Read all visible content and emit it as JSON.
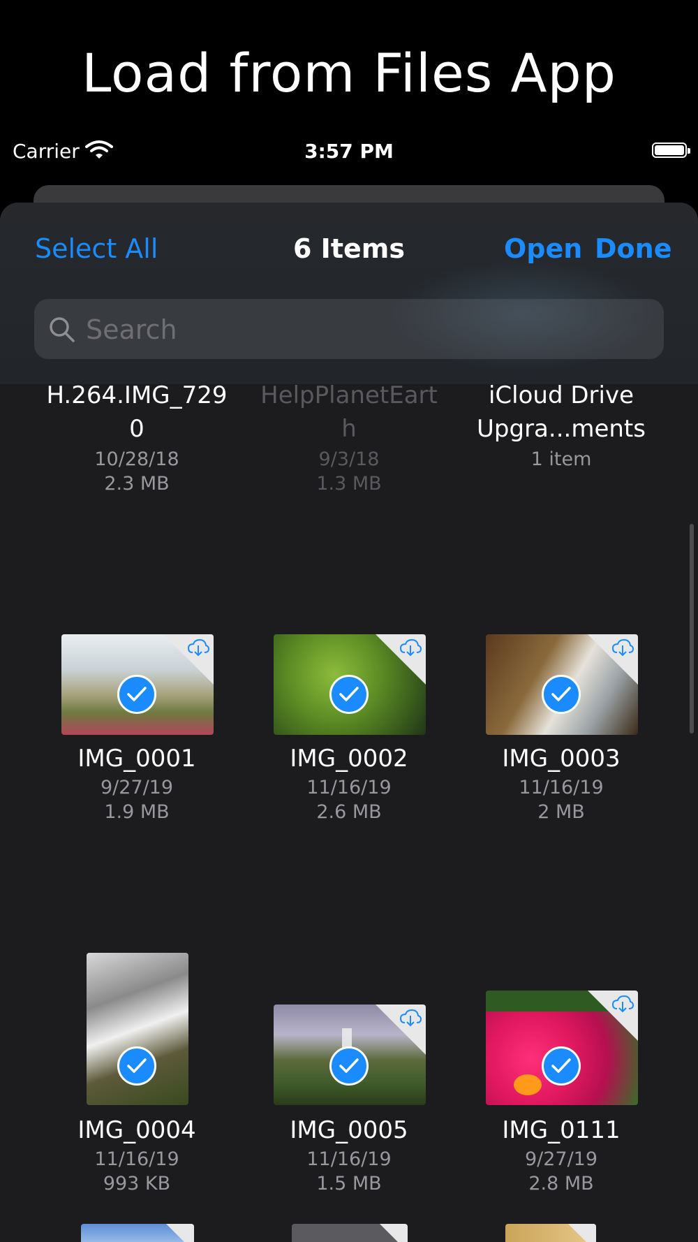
{
  "headline": "Load from Files App",
  "status_bar": {
    "carrier": "Carrier",
    "time": "3:57 PM"
  },
  "nav": {
    "left": "Select All",
    "title": "6 Items",
    "open": "Open",
    "done": "Done"
  },
  "search": {
    "placeholder": "Search"
  },
  "top_row": [
    {
      "name": "H.264.IMG_729\n0",
      "date": "10/28/18",
      "size": "2.3 MB"
    },
    {
      "name": "HelpPlanetEart\nh",
      "date": "9/3/18",
      "size": "1.3 MB"
    },
    {
      "name": "iCloud Drive\nUpgra...ments",
      "date": "1 item",
      "size": ""
    }
  ],
  "files": [
    {
      "name": "IMG_0001",
      "date": "9/27/19",
      "size": "1.9 MB",
      "selected": true,
      "cloud": true
    },
    {
      "name": "IMG_0002",
      "date": "11/16/19",
      "size": "2.6 MB",
      "selected": true,
      "cloud": true
    },
    {
      "name": "IMG_0003",
      "date": "11/16/19",
      "size": "2 MB",
      "selected": true,
      "cloud": true
    },
    {
      "name": "IMG_0004",
      "date": "11/16/19",
      "size": "993 KB",
      "selected": true,
      "cloud": false
    },
    {
      "name": "IMG_0005",
      "date": "11/16/19",
      "size": "1.5 MB",
      "selected": true,
      "cloud": true
    },
    {
      "name": "IMG_0111",
      "date": "9/27/19",
      "size": "2.8 MB",
      "selected": true,
      "cloud": true
    }
  ],
  "colors": {
    "accent": "#1a8cff",
    "background": "#1c1c1e",
    "secondary_text": "#98989d"
  }
}
